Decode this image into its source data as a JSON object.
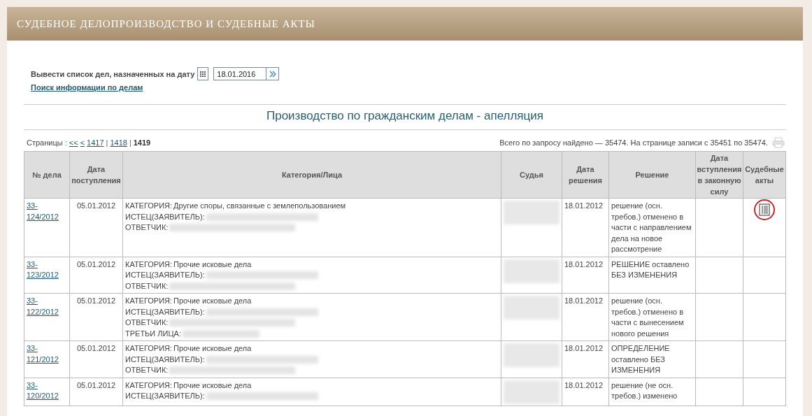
{
  "header": {
    "title": "СУДЕБНОЕ ДЕЛОПРОИЗВОДСТВО И СУДЕБНЫЕ АКТЫ"
  },
  "date_form": {
    "label": "Вывести список дел, назначенных на дату",
    "value": "18.01.2016",
    "search_link": "Поиск информации по делам"
  },
  "section_title": "Производство по гражданским делам - апелляция",
  "pagination": {
    "label": "Страницы :",
    "separator": "|",
    "links": [
      {
        "text": "<<",
        "selected": false
      },
      {
        "text": "<",
        "selected": false
      },
      {
        "text": "1417",
        "selected": false
      },
      {
        "text": "1418",
        "selected": false
      },
      {
        "text": "1419",
        "selected": true
      }
    ],
    "summary": "Всего по запросу найдено — 35474. На странице записи с 35451 по 35474."
  },
  "table": {
    "columns": [
      "№ дела",
      "Дата поступления",
      "Категория/Лица",
      "Судья",
      "Дата решения",
      "Решение",
      "Дата вступления в законную силу",
      "Судебные акты"
    ],
    "rows": [
      {
        "case": "33-124/2012",
        "received": "05.01.2012",
        "parties": [
          {
            "label": "КАТЕГОРИЯ:",
            "value": "Другие споры, связанные с землепользованием"
          },
          {
            "label": "ИСТЕЦ(ЗАЯВИТЕЛЬ):",
            "redacted": true
          },
          {
            "label": "ОТВЕТЧИК:",
            "redacted": true
          }
        ],
        "judge_redacted": true,
        "decided": "18.01.2012",
        "decision": "решение (осн. требов.) отменено в части с направлением дела на новое рассмотрение",
        "has_act": true
      },
      {
        "case": "33-123/2012",
        "received": "05.01.2012",
        "parties": [
          {
            "label": "КАТЕГОРИЯ:",
            "value": "Прочие исковые дела"
          },
          {
            "label": "ИСТЕЦ(ЗАЯВИТЕЛЬ):",
            "redacted": true
          },
          {
            "label": "ОТВЕТЧИК:",
            "redacted": true
          }
        ],
        "judge_redacted": true,
        "decided": "18.01.2012",
        "decision": "РЕШЕНИЕ оставлено БЕЗ ИЗМЕНЕНИЯ",
        "has_act": false
      },
      {
        "case": "33-122/2012",
        "received": "05.01.2012",
        "parties": [
          {
            "label": "КАТЕГОРИЯ:",
            "value": "Прочие исковые дела"
          },
          {
            "label": "ИСТЕЦ(ЗАЯВИТЕЛЬ):",
            "redacted": true
          },
          {
            "label": "ОТВЕТЧИК:",
            "redacted": true
          },
          {
            "label": "ТРЕТЬИ ЛИЦА:",
            "redacted": true
          }
        ],
        "judge_redacted": true,
        "decided": "18.01.2012",
        "decision": "решение (осн. требов.) отменено в части с вынесением нового решения",
        "has_act": false
      },
      {
        "case": "33-121/2012",
        "received": "05.01.2012",
        "parties": [
          {
            "label": "КАТЕГОРИЯ:",
            "value": "Прочие исковые дела"
          },
          {
            "label": "ИСТЕЦ(ЗАЯВИТЕЛЬ):",
            "redacted": true
          },
          {
            "label": "ОТВЕТЧИК:",
            "redacted": true
          }
        ],
        "judge_redacted": true,
        "decided": "18.01.2012",
        "decision": "ОПРЕДЕЛЕНИЕ оставлено БЕЗ ИЗМЕНЕНИЯ",
        "has_act": false
      },
      {
        "case": "33-120/2012",
        "received": "05.01.2012",
        "parties": [
          {
            "label": "КАТЕГОРИЯ:",
            "value": "Прочие исковые дела"
          },
          {
            "label": "ИСТЕЦ(ЗАЯВИТЕЛЬ):",
            "redacted": true
          }
        ],
        "judge_redacted": true,
        "decided": "18.01.2012",
        "decision": "решение (не осн. требов.) изменено",
        "has_act": false
      }
    ]
  }
}
